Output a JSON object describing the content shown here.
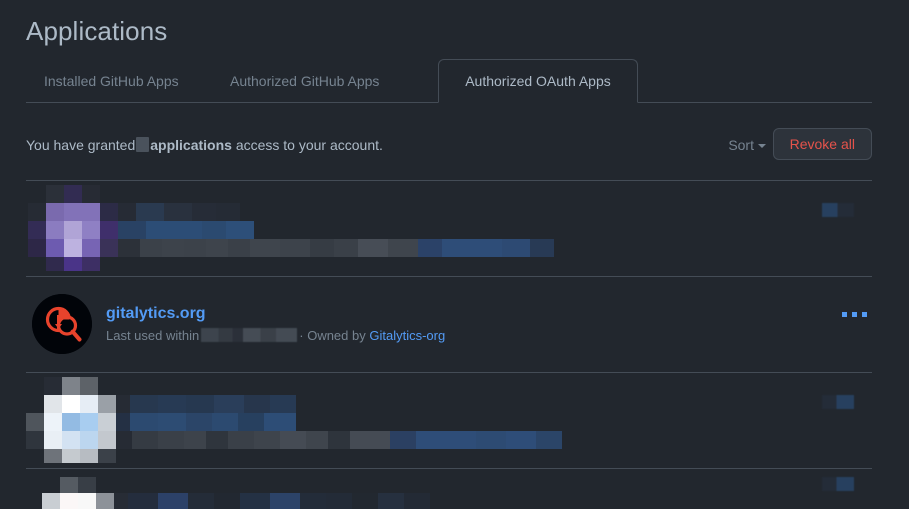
{
  "page": {
    "title": "Applications",
    "background_color": "#22272e",
    "text_color": "#adbac7",
    "link_color": "#539bf5",
    "danger_color": "#e5534b",
    "border_color": "#444c56"
  },
  "tabs": [
    {
      "label": "Installed GitHub Apps",
      "active": false
    },
    {
      "label": "Authorized GitHub Apps",
      "active": false
    },
    {
      "label": "Authorized OAuth Apps",
      "active": true
    }
  ],
  "granted": {
    "prefix": "You have granted",
    "count_redacted": true,
    "bold_word": "applications",
    "suffix": "access to your account."
  },
  "toolbar": {
    "sort_label": "Sort",
    "sort_icon": "chevron-down-icon",
    "revoke_all_label": "Revoke all"
  },
  "apps": [
    {
      "index": 0,
      "redacted": true,
      "name": "",
      "meta": "",
      "owner": "",
      "avatar_style": "pixelated-purple",
      "right_control": "redacted-badge"
    },
    {
      "index": 1,
      "redacted": false,
      "name": "gitalytics.org",
      "meta_prefix": "Last used within",
      "meta_redacted": true,
      "meta_separator": "·",
      "meta_owner_prefix": "Owned by",
      "owner": "Gitalytics-org",
      "avatar_style": "gitalytics-logo",
      "avatar_bg": "#010409",
      "avatar_fg": "#e8432c",
      "right_control": "kebab-menu"
    },
    {
      "index": 2,
      "redacted": true,
      "name": "",
      "meta": "",
      "owner": "",
      "avatar_style": "pixelated-white-blue",
      "right_control": "redacted-badge"
    },
    {
      "index": 3,
      "redacted": true,
      "partial": true,
      "name": "",
      "meta": "",
      "owner": "",
      "avatar_style": "pixelated-white-blue",
      "right_control": "redacted-badge"
    }
  ]
}
